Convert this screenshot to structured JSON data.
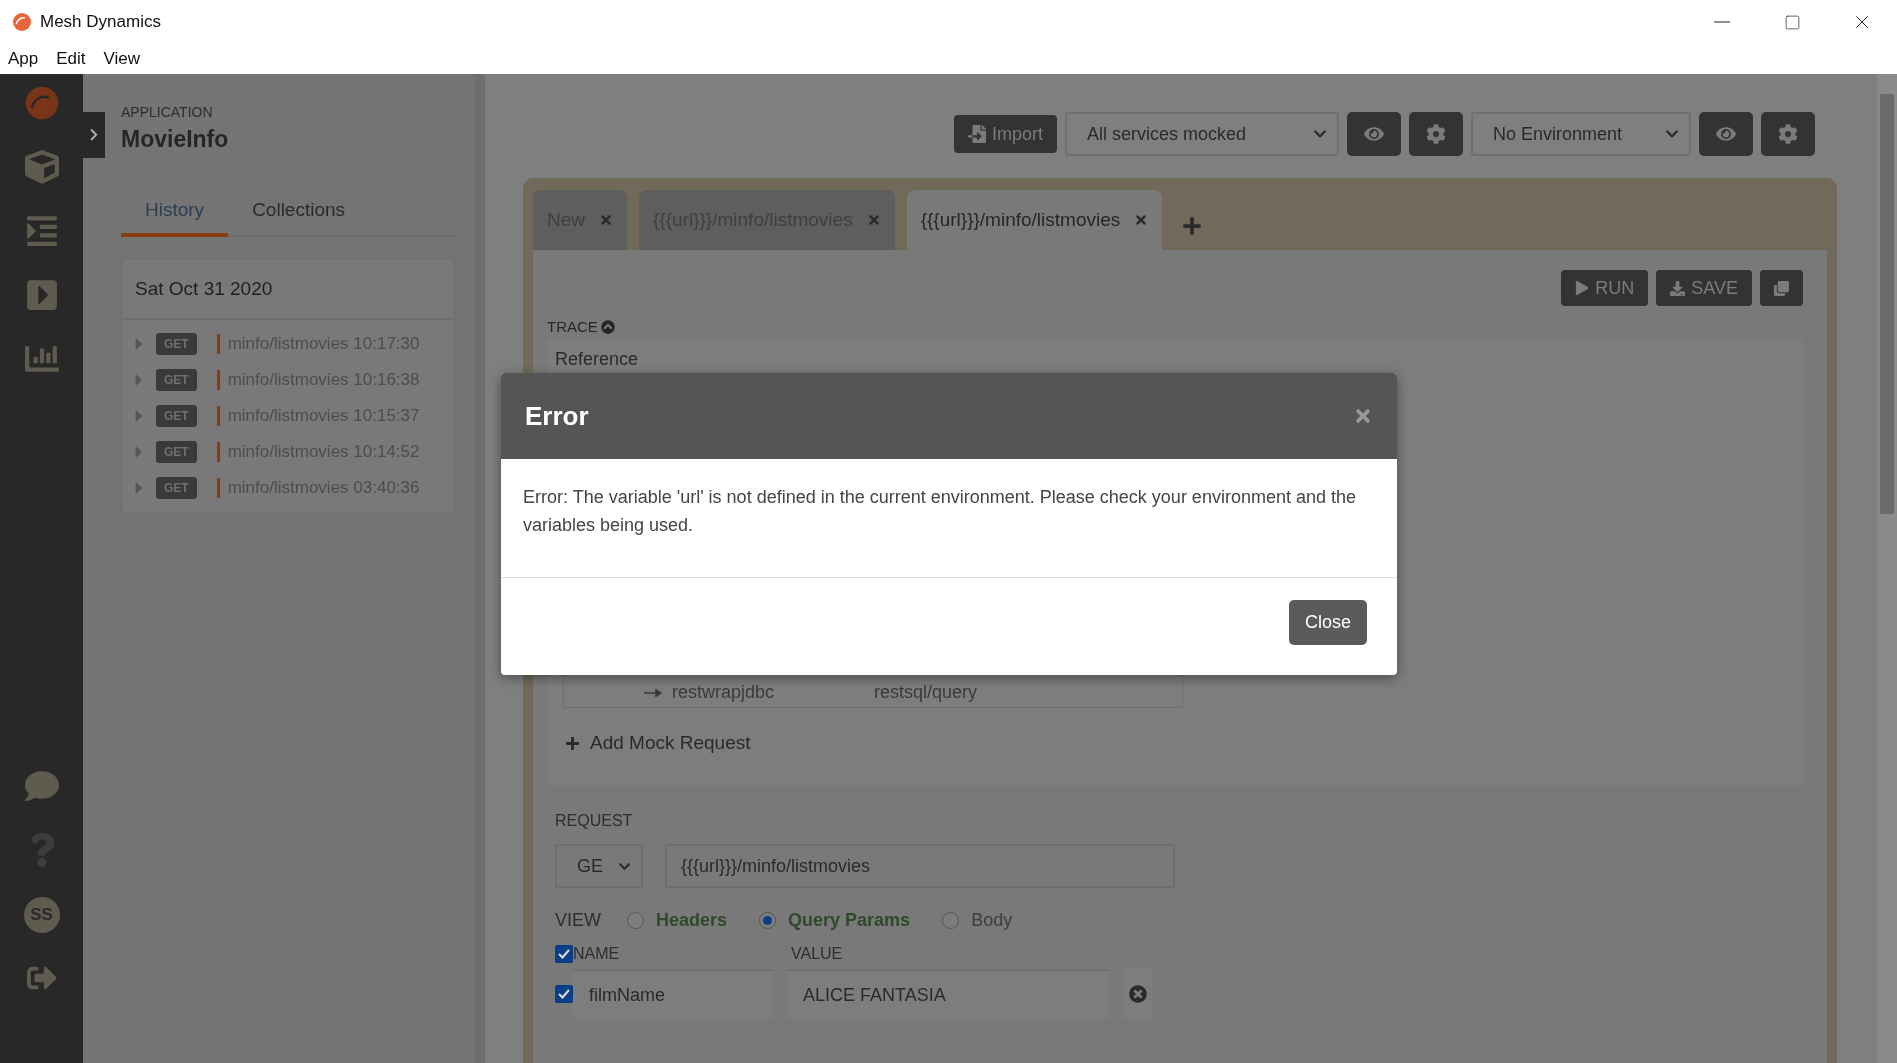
{
  "window": {
    "title": "Mesh Dynamics"
  },
  "menu": [
    "App",
    "Edit",
    "View"
  ],
  "rail": {
    "avatar": "SS"
  },
  "app": {
    "label": "APPLICATION",
    "name": "MovieInfo"
  },
  "side_tabs": [
    {
      "label": "History",
      "selected": true
    },
    {
      "label": "Collections",
      "selected": false
    }
  ],
  "history": {
    "date": "Sat Oct 31 2020",
    "items": [
      {
        "method": "GET",
        "path": "minfo/listmovies 10:17:30"
      },
      {
        "method": "GET",
        "path": "minfo/listmovies 10:16:38"
      },
      {
        "method": "GET",
        "path": "minfo/listmovies 10:15:37"
      },
      {
        "method": "GET",
        "path": "minfo/listmovies 10:14:52"
      },
      {
        "method": "GET",
        "path": "minfo/listmovies 03:40:36"
      }
    ]
  },
  "toolbar": {
    "import": "Import",
    "mock_select": "All services mocked",
    "env_select": "No Environment"
  },
  "tabs": [
    {
      "label": "New",
      "selected": false
    },
    {
      "label": "{{{url}}}/minfo/listmovies",
      "selected": false
    },
    {
      "label": "{{{url}}}/minfo/listmovies",
      "selected": true
    }
  ],
  "actions": {
    "run": "RUN",
    "save": "SAVE"
  },
  "trace": {
    "label": "TRACE",
    "reference": "Reference",
    "mock_row": {
      "service": "restwrapjdbc",
      "path": "restsql/query"
    },
    "add_mock": "Add Mock Request"
  },
  "request": {
    "label": "REQUEST",
    "method": "GE",
    "url": "{{{url}}}/minfo/listmovies",
    "view_label": "VIEW",
    "views": [
      {
        "label": "Headers",
        "selected": false,
        "highlighted": true
      },
      {
        "label": "Query Params",
        "selected": true,
        "highlighted": true
      },
      {
        "label": "Body",
        "selected": false,
        "highlighted": false
      }
    ],
    "all_checked": true,
    "name_header": "NAME",
    "value_header": "VALUE",
    "params": [
      {
        "name": "filmName",
        "value": "ALICE FANTASIA",
        "checked": true
      }
    ]
  },
  "dialog": {
    "title": "Error",
    "message": "Error: The variable 'url' is not defined in the current environment. Please check your environment and the variables being used.",
    "button": "Close"
  }
}
